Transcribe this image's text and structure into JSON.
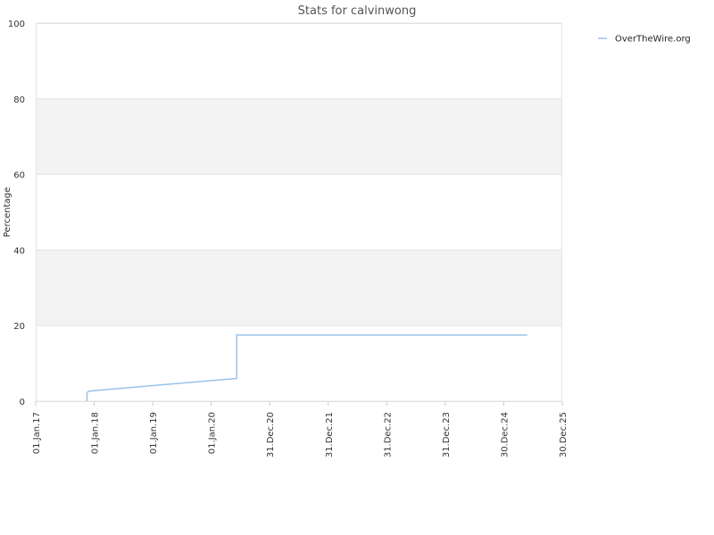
{
  "chart_data": {
    "type": "line",
    "title": "Stats for calvinwong",
    "xlabel": "",
    "ylabel": "Percentage",
    "ylim": [
      0,
      100
    ],
    "yticks": [
      0,
      20,
      40,
      60,
      80,
      100
    ],
    "xlim": [
      "2017-01-01",
      "2025-12-30"
    ],
    "xticks": [
      {
        "date": "2017-01-01",
        "label": "01.Jan.17"
      },
      {
        "date": "2018-01-01",
        "label": "01.Jan.18"
      },
      {
        "date": "2019-01-01",
        "label": "01.Jan.19"
      },
      {
        "date": "2020-01-01",
        "label": "01.Jan.20"
      },
      {
        "date": "2020-12-31",
        "label": "31.Dec.20"
      },
      {
        "date": "2021-12-31",
        "label": "31.Dec.21"
      },
      {
        "date": "2022-12-31",
        "label": "31.Dec.22"
      },
      {
        "date": "2023-12-31",
        "label": "31.Dec.23"
      },
      {
        "date": "2024-12-30",
        "label": "30.Dec.24"
      },
      {
        "date": "2025-12-30",
        "label": "30.Dec.25"
      }
    ],
    "grid": "horizontal, alternating bands",
    "legend": "top-right",
    "series": [
      {
        "name": "OverTheWire.org",
        "color": "#99c3ea",
        "points": [
          {
            "x": "2017-11-17",
            "y": 0
          },
          {
            "x": "2017-11-17",
            "y": 2.3
          },
          {
            "x": "2017-11-30",
            "y": 2.7
          },
          {
            "x": "2020-05-25",
            "y": 6.0
          },
          {
            "x": "2020-06-08",
            "y": 6.0
          },
          {
            "x": "2020-06-08",
            "y": 17.5
          },
          {
            "x": "2025-05-25",
            "y": 17.5
          }
        ]
      }
    ]
  }
}
